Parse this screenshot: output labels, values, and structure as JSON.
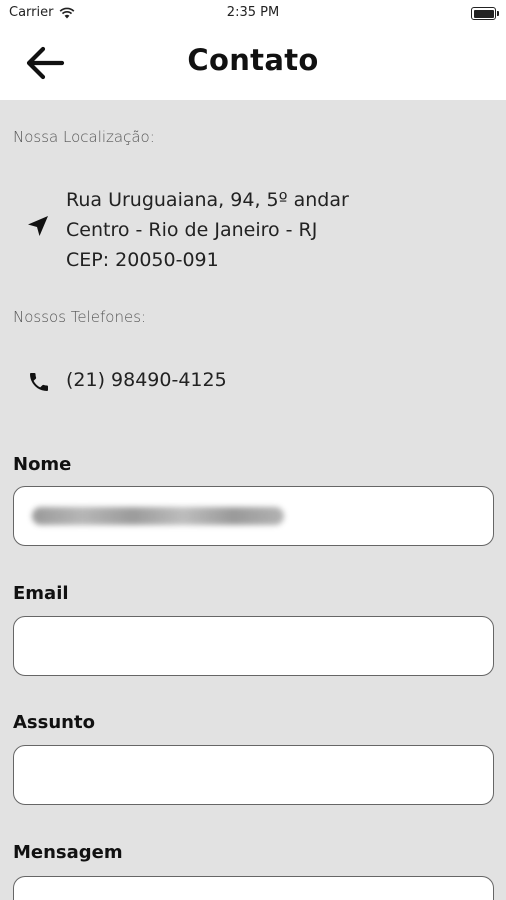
{
  "status": {
    "carrier": "Carrier",
    "time": "2:35 PM"
  },
  "nav": {
    "title": "Contato"
  },
  "location": {
    "label": "Nossa Localização:",
    "line1": "Rua Uruguaiana, 94, 5º andar",
    "line2": "Centro - Rio de Janeiro - RJ",
    "line3": "CEP: 20050-091"
  },
  "phones": {
    "label": "Nossos Telefones:",
    "number": "(21) 98490-4125"
  },
  "form": {
    "nome_label": "Nome",
    "email_label": "Email",
    "assunto_label": "Assunto",
    "mensagem_label": "Mensagem"
  }
}
